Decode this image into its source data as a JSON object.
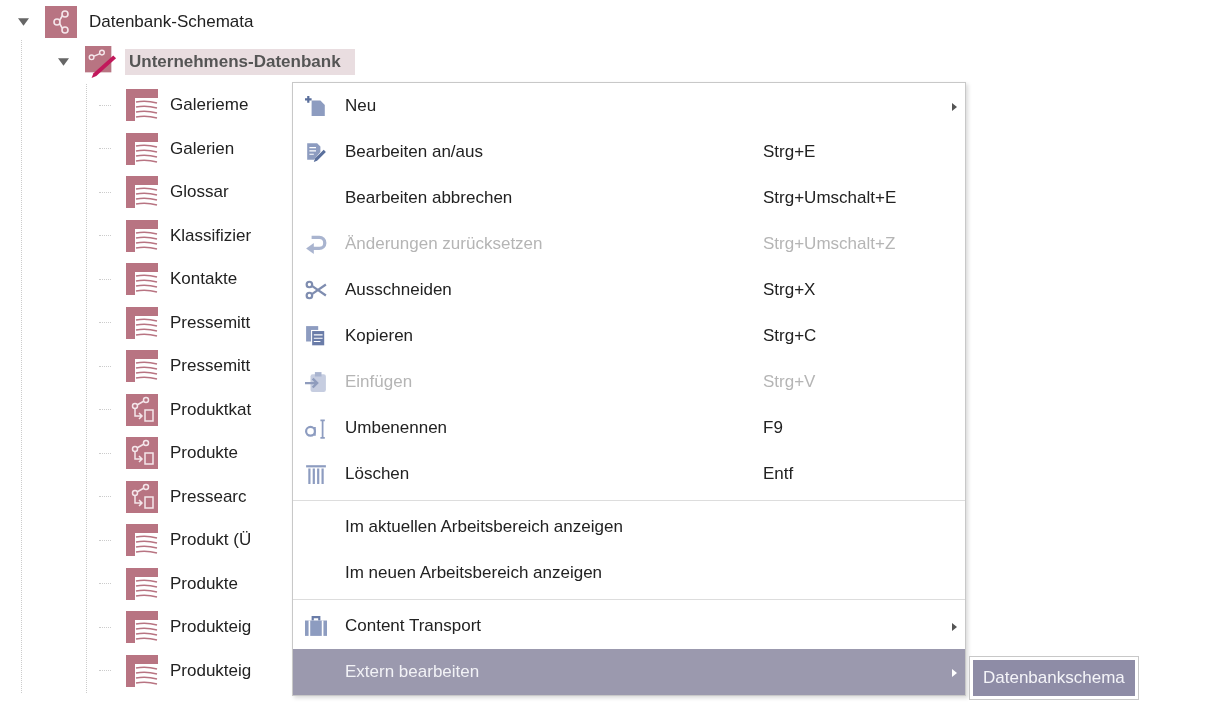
{
  "tree": [
    {
      "label": "Datenbank-Schemata",
      "kind": "schema",
      "expanded": true,
      "selected": false,
      "children": [
        {
          "label": "Unternehmens-Datenbank",
          "kind": "schema-edit",
          "expanded": true,
          "selected": true,
          "children": [
            {
              "label": "Galerieme",
              "kind": "table",
              "selected": false
            },
            {
              "label": "Galerien",
              "kind": "table",
              "selected": false
            },
            {
              "label": "Glossar",
              "kind": "table",
              "selected": false
            },
            {
              "label": "Klassifizier",
              "kind": "table",
              "selected": false
            },
            {
              "label": "Kontakte",
              "kind": "table",
              "selected": false
            },
            {
              "label": "Pressemitt",
              "kind": "table",
              "selected": false
            },
            {
              "label": "Pressemitt",
              "kind": "table",
              "selected": false
            },
            {
              "label": "Produktkat",
              "kind": "query",
              "selected": false
            },
            {
              "label": "Produkte",
              "kind": "query",
              "selected": false
            },
            {
              "label": "Pressearc",
              "kind": "query",
              "selected": false
            },
            {
              "label": "Produkt (Ü",
              "kind": "table",
              "selected": false
            },
            {
              "label": "Produkte",
              "kind": "table",
              "selected": false
            },
            {
              "label": "Produkteig",
              "kind": "table",
              "selected": false
            },
            {
              "label": "Produkteig",
              "kind": "table",
              "selected": false
            }
          ]
        }
      ]
    }
  ],
  "context_menu": [
    {
      "kind": "item",
      "label": "Neu",
      "submenu": true,
      "disabled": false,
      "selected": false
    },
    {
      "kind": "item",
      "label": "Bearbeiten an/aus",
      "shortcut": "Strg+E",
      "disabled": false,
      "selected": false
    },
    {
      "kind": "item",
      "label": "Bearbeiten abbrechen",
      "shortcut": "Strg+Umschalt+E",
      "disabled": false,
      "selected": false
    },
    {
      "kind": "item",
      "label": "Änderungen zurücksetzen",
      "shortcut": "Strg+Umschalt+Z",
      "disabled": true,
      "selected": false
    },
    {
      "kind": "item",
      "label": "Ausschneiden",
      "shortcut": "Strg+X",
      "disabled": false,
      "selected": false
    },
    {
      "kind": "item",
      "label": "Kopieren",
      "shortcut": "Strg+C",
      "disabled": false,
      "selected": false
    },
    {
      "kind": "item",
      "label": "Einfügen",
      "shortcut": "Strg+V",
      "disabled": true,
      "selected": false
    },
    {
      "kind": "item",
      "label": "Umbenennen",
      "shortcut": "F9",
      "disabled": false,
      "selected": false
    },
    {
      "kind": "item",
      "label": "Löschen",
      "shortcut": "Entf",
      "disabled": false,
      "selected": false
    },
    {
      "kind": "separator"
    },
    {
      "kind": "item",
      "label": "Im aktuellen Arbeitsbereich anzeigen",
      "disabled": false,
      "selected": false
    },
    {
      "kind": "item",
      "label": "Im neuen Arbeitsbereich anzeigen",
      "disabled": false,
      "selected": false
    },
    {
      "kind": "separator"
    },
    {
      "kind": "item",
      "label": "Content Transport",
      "submenu": true,
      "disabled": false,
      "selected": false
    },
    {
      "kind": "item",
      "label": "Extern bearbeiten",
      "submenu": true,
      "disabled": false,
      "selected": true
    }
  ],
  "submenu": [
    {
      "label": "Datenbankschema",
      "selected": true
    }
  ]
}
